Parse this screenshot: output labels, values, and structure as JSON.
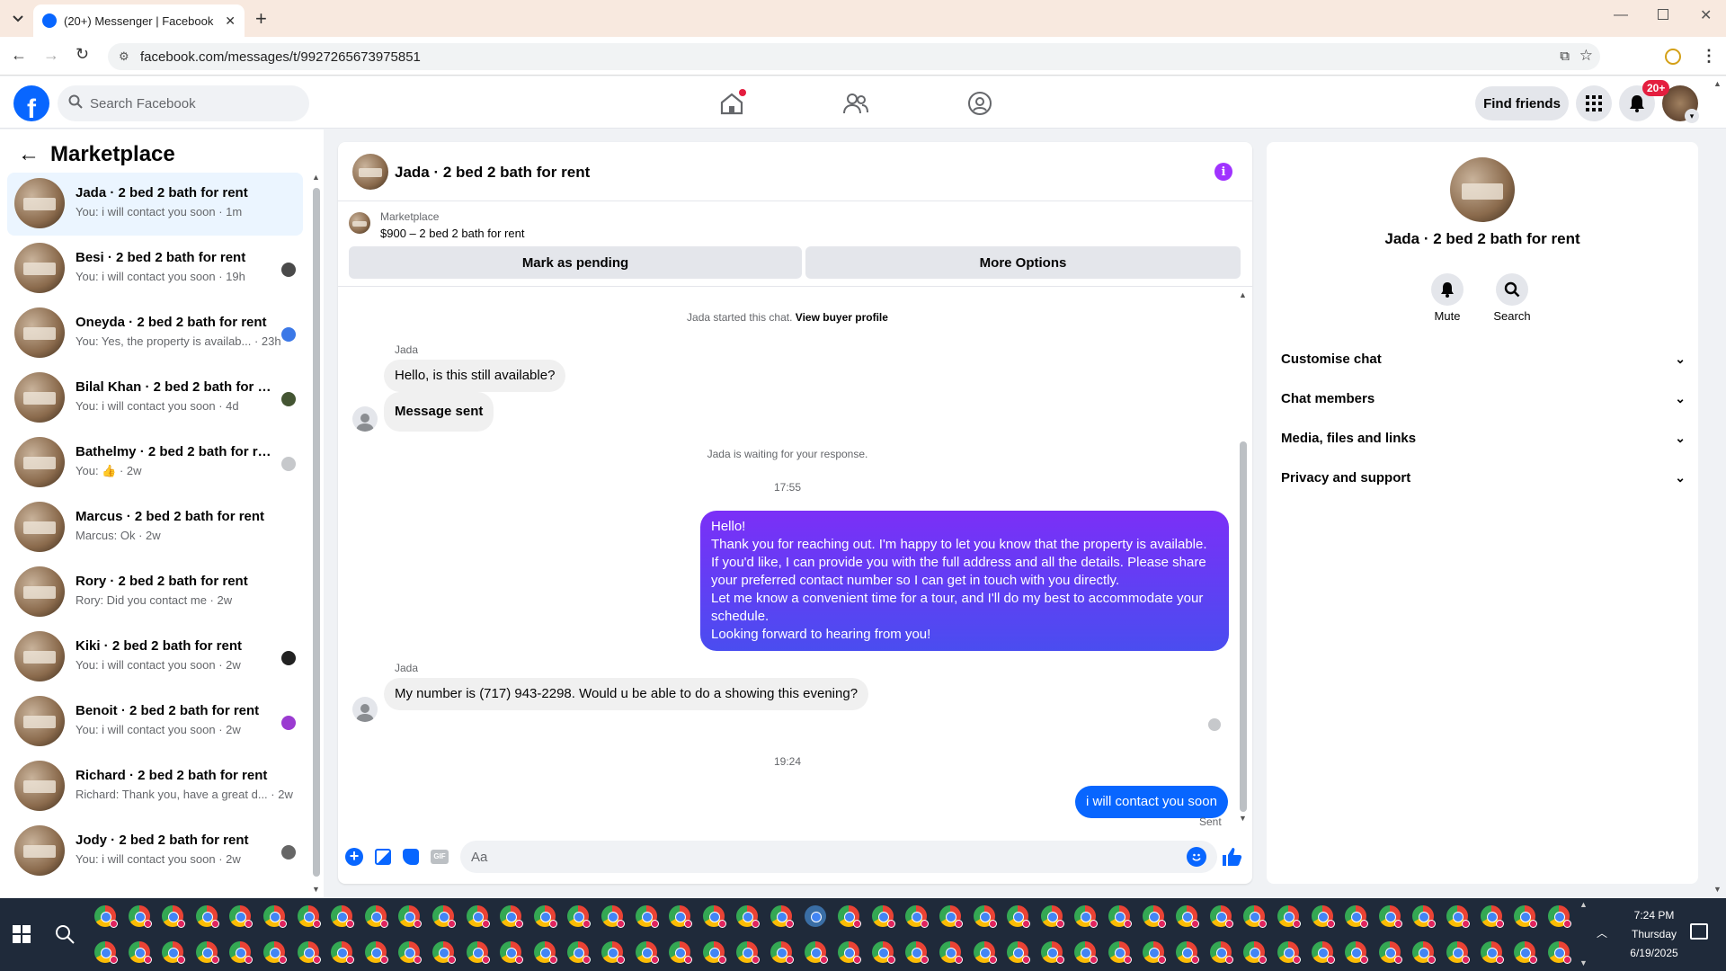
{
  "browser": {
    "tab_title": "(20+) Messenger | Facebook",
    "url": "facebook.com/messages/t/9927265673975851"
  },
  "fb": {
    "search_placeholder": "Search Facebook",
    "find_friends": "Find friends",
    "notif_badge": "20+"
  },
  "sidebar": {
    "title": "Marketplace",
    "conversations": [
      {
        "name": "Jada · 2 bed 2 bath for rent",
        "preview": "You: i will contact you soon · 1m",
        "active": true
      },
      {
        "name": "Besi · 2 bed 2 bath for rent",
        "preview": "You: i will contact you soon · 19h"
      },
      {
        "name": "Oneyda · 2 bed 2 bath for rent",
        "preview": "You: Yes, the property is availab... · 23h"
      },
      {
        "name": "Bilal Khan · 2 bed 2 bath for r...",
        "preview": "You: i will contact you soon · 4d"
      },
      {
        "name": "Bathelmy · 2 bed 2 bath for re...",
        "preview": "You: 👍 · 2w"
      },
      {
        "name": "Marcus · 2 bed 2 bath for rent",
        "preview": "Marcus: Ok · 2w"
      },
      {
        "name": "Rory · 2 bed 2 bath for rent",
        "preview": "Rory: Did you contact me · 2w"
      },
      {
        "name": "Kiki · 2 bed 2 bath for rent",
        "preview": "You: i will contact you soon · 2w"
      },
      {
        "name": "Benoit · 2 bed 2 bath for rent",
        "preview": "You: i will contact you soon · 2w"
      },
      {
        "name": "Richard · 2 bed 2 bath for rent",
        "preview": "Richard: Thank you, have a great d... · 2w"
      },
      {
        "name": "Jody · 2 bed 2 bath for rent",
        "preview": "You: i will contact you soon · 2w"
      }
    ]
  },
  "chat": {
    "header_title": "Jada · 2 bed 2 bath for rent",
    "listing_label": "Marketplace",
    "listing_title": "$900 – 2 bed 2 bath for rent",
    "mark_pending": "Mark as pending",
    "more_options": "More Options",
    "started_text": "Jada started this chat.",
    "view_profile": "View buyer profile",
    "sender_name": "Jada",
    "msg1": "Hello, is this still available?",
    "msg2": "Message sent",
    "waiting": "Jada is waiting for your response.",
    "time1": "17:55",
    "out_lines": [
      "Hello!",
      "Thank you for reaching out. I'm happy to let you know that the property is available.",
      "If you'd like, I can provide you with the full address and all the details. Please share",
      "your preferred contact number so I can get in touch with you directly.",
      "Let me know a convenient time for a tour, and I'll do my best to accommodate your",
      "schedule.",
      "Looking forward to hearing from you!"
    ],
    "sender_name2": "Jada",
    "msg3": "My number is (717) 943-2298.  Would u be able to do a showing this evening?",
    "time2": "19:24",
    "out2": "i will contact you soon",
    "sent_label": "Sent",
    "composer_placeholder": "Aa"
  },
  "right": {
    "name": "Jada · 2 bed 2 bath for rent",
    "mute": "Mute",
    "search": "Search",
    "rows": [
      "Customise chat",
      "Chat members",
      "Media, files and links",
      "Privacy and support"
    ]
  },
  "taskbar": {
    "time": "7:24 PM",
    "day": "Thursday",
    "date": "6/19/2025"
  },
  "colors": {
    "fb_blue": "#0866ff",
    "bubble_out": "#5b3ef5",
    "badge_red": "#e41e3f"
  }
}
